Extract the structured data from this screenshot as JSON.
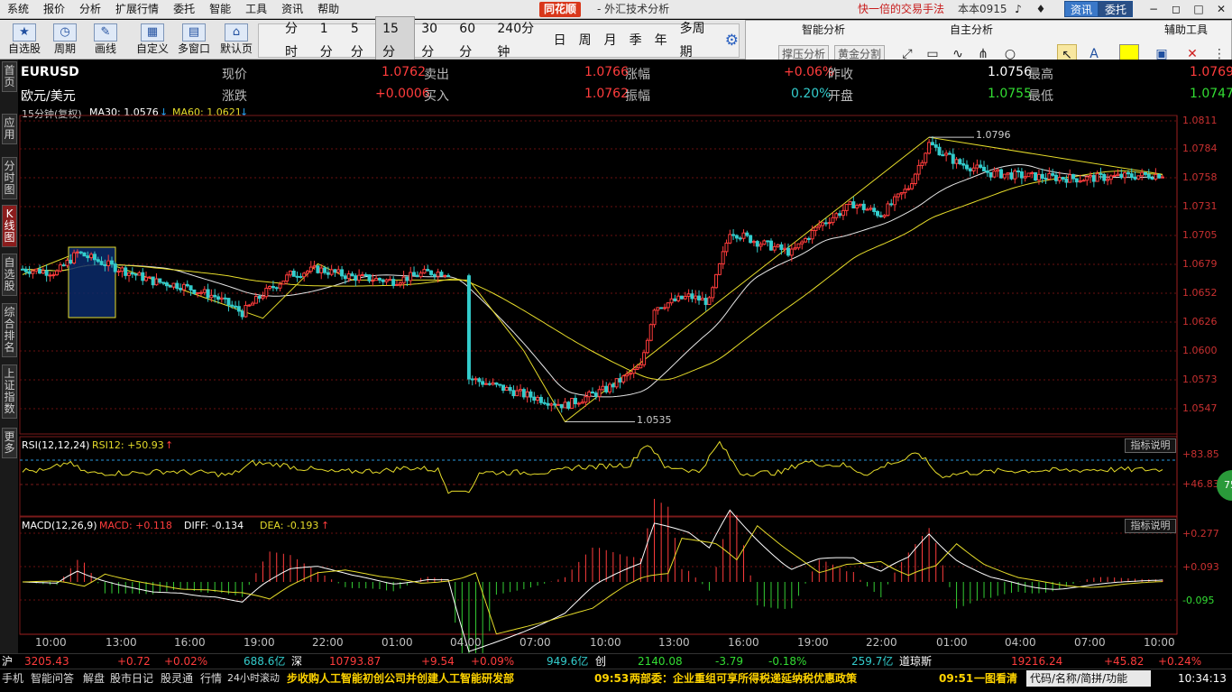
{
  "menu": {
    "items": [
      "系统",
      "报价",
      "分析",
      "扩展行情",
      "委托",
      "智能",
      "工具",
      "资讯",
      "帮助"
    ],
    "brand": "同花顺",
    "app_title": "- 外汇技术分析",
    "promo": "快一倍的交易手法",
    "version": "本本0915",
    "btn_news": "资讯",
    "btn_trade": "委托"
  },
  "toolbar": {
    "auto_select": "自选股",
    "period": "周期",
    "draw": "画线",
    "custom": "自定义",
    "multi_window": "多窗口",
    "default_page": "默认页"
  },
  "periods": [
    "分时",
    "1分",
    "5分",
    "15分",
    "30分",
    "60分",
    "240分钟",
    "日",
    "周",
    "月",
    "季",
    "年",
    "多周期"
  ],
  "right_panel": {
    "smart_analysis": "智能分析",
    "self_analysis": "自主分析",
    "aux_tools": "辅助工具",
    "support_pressure": "撑压分析",
    "golden_split": "黄金分割"
  },
  "side_tabs": [
    "首页",
    "应用",
    "分时图",
    "K线图",
    "自选股",
    "综合排名",
    "上证指数",
    "更多"
  ],
  "quote": {
    "symbol": "EURUSD",
    "name": "欧元/美元",
    "now_label": "现价",
    "now": "1.0762",
    "change_label": "涨跌",
    "change": "+0.0006",
    "sell_label": "卖出",
    "sell": "1.0766",
    "buy_label": "买入",
    "buy": "1.0762",
    "rise_label": "涨幅",
    "rise": "+0.06%",
    "amp_label": "振幅",
    "amp": "0.20%",
    "prevclose_label": "昨收",
    "prevclose": "1.0756",
    "open_label": "开盘",
    "open": "1.0755",
    "high_label": "最高",
    "high": "1.0769",
    "low_label": "最低",
    "low": "1.0747"
  },
  "main_chart": {
    "header": "15分钟(复权)",
    "ma30_label": "MA30: 1.0576",
    "ma60_label": "MA60: 1.0621",
    "max_label": "1.0796",
    "min_label": "1.0535",
    "y_ticks": [
      "1.0811",
      "1.0784",
      "1.0758",
      "1.0731",
      "1.0705",
      "1.0679",
      "1.0652",
      "1.0626",
      "1.0600",
      "1.0573",
      "1.0547"
    ]
  },
  "rsi_panel": {
    "header": "RSI(12,12,24)",
    "rsi12": "RSI12: +50.93",
    "explain": "指标说明",
    "y_top": "+83.85",
    "y_mid": "+46.83",
    "badge": "75"
  },
  "macd_panel": {
    "header": "MACD(12,26,9)",
    "macd": "MACD: +0.118",
    "diff": "DIFF: -0.134",
    "dea": "DEA: -0.193",
    "explain": "指标说明",
    "y_ticks": [
      "+0.277",
      "+0.093",
      "-0.095"
    ]
  },
  "x_axis": [
    "10:00",
    "13:00",
    "16:00",
    "19:00",
    "22:00",
    "01:00",
    "04:00",
    "07:00",
    "10:00",
    "13:00",
    "16:00",
    "19:00",
    "22:00",
    "01:00",
    "04:00",
    "07:00",
    "10:00"
  ],
  "status_bar": {
    "sh": "沪",
    "sh_value": "3205.43",
    "sh_change": "+0.72",
    "sh_pct": "+0.02%",
    "sh_amount": "688.6亿",
    "sz": "深",
    "sz_value": "10793.87",
    "sz_change": "+9.54",
    "sz_pct": "+0.09%",
    "sz_amount": "949.6亿",
    "cy": "创",
    "cy_value": "2140.08",
    "cy_change": "-3.79",
    "cy_pct": "-0.18%",
    "cy_amount": "259.7亿",
    "dj": "道琼斯",
    "dj_value": "19216.24",
    "dj_change": "+45.82",
    "dj_pct": "+0.24%"
  },
  "bottom_bar": {
    "links": [
      "手机",
      "智能问答",
      "解盘",
      "股市日记",
      "股灵通",
      "行情",
      "24小时滚动"
    ],
    "news1": "步收购人工智能初创公司并创建人工智能研发部",
    "news2_time": "09:53",
    "news2": "两部委：企业重组可享所得税递延纳税优惠政策",
    "news3_time": "09:51",
    "news3": "一图看清",
    "search": "代码/名称/简拼/功能",
    "clock": "10:34:13"
  },
  "colors": {
    "up": "#ff3c3c",
    "down": "#33cccc",
    "ma30": "#e6e6e6",
    "ma60": "#e6dc2a",
    "grid": "#6a1010",
    "bg": "#000000"
  }
}
